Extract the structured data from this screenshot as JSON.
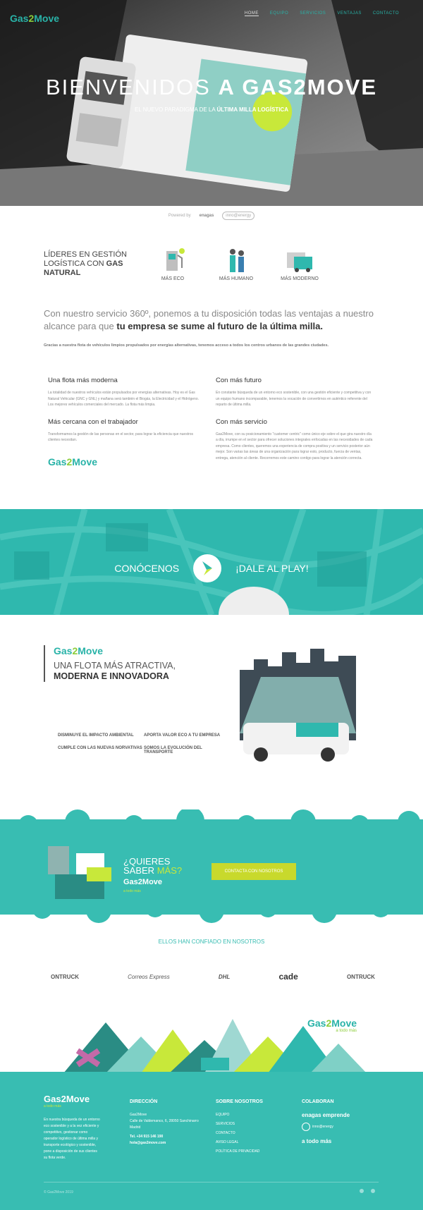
{
  "header": {
    "logo_prefix": "Gas",
    "logo_two": "2",
    "logo_suffix": "Move",
    "nav": [
      "HOME",
      "EQUIPO",
      "SERVICIOS",
      "VENTAJAS",
      "CONTACTO"
    ]
  },
  "hero": {
    "title_light": "BIENVENIDOS ",
    "title_bold": "A GAS2MOVE",
    "subtitle_pre": "EL NUEVO PARADIGMA DE LA ",
    "subtitle_bold": "ÚLTIMA MILLA LOGÍSTICA"
  },
  "powered": {
    "label": "Powered by",
    "brand1": "enagas",
    "brand2": "inno@energy"
  },
  "leaders": {
    "line1": "LÍDERES EN GESTIÓN",
    "line2": "LOGÍSTICA CON ",
    "line2_bold": "GAS",
    "line3": "NATURAL"
  },
  "pillars": [
    {
      "label": "MÁS ECO",
      "icon": "gas-pump-icon"
    },
    {
      "label": "MÁS HUMANO",
      "icon": "people-icon"
    },
    {
      "label": "MÁS MODERNO",
      "icon": "van-icon"
    }
  ],
  "intro": {
    "text1": "Con nuestro servicio 360º, ponemos a tu disposición todas las ventajas a nuestro alcance para que ",
    "bold": "tu empresa se sume al futuro de la última milla.",
    "note": "Gracias a nuestra flota de vehículos limpios propulsados por energías alternativas, tenemos acceso a todos los centros urbanos de las grandes ciudades."
  },
  "features": {
    "f1_title": "Una flota más moderna",
    "f1_text": "La totalidad de nuestros vehículos están propulsados por energías alternativas. Hoy es el Gas Natural Vehicular (GNC y GNL) y mañana será también el Biogás, la Electricidad y el Hidrógeno. Los mejores vehículos comerciales del mercado. La flota más limpia.",
    "f2_title": "Más cercana con el trabajador",
    "f2_text": "Transformamos la gestión de las personas en el sector, para lograr la eficiencia que nuestros clientes necesitan.",
    "f3_title": "Con más futuro",
    "f3_text": "En constante búsqueda de un entorno eco sostenible, con una gestión eficiente y competitiva y con un equipo humano incomparable, tenemos la vocación de convertirnos en auténtico referente del reparto de última milla.",
    "f4_title": "Con más servicio",
    "f4_text": "Gas2Move, con su posicionamiento \"customer centric\" como único eje sobre el que gira nuestro día a día, irrumpe en el sector para ofrecer soluciones integrales enfocadas en las necesidades de cada empresa. Como clientes, queremos una experiencia de compra positiva y un servicio posterior aún mejor. Son varias las áreas de una organización para lograr esto, producto, fuerza de ventas, entrega, atención al cliente. Recorremos este camino contigo para lograr la atención correcta."
  },
  "video": {
    "left": "CONÓCENOS",
    "right": "¡DALE AL PLAY!"
  },
  "fleet": {
    "title_line1": "UNA FLOTA MÁS ATRACTIVA,",
    "title_line2": "MODERNA E INNOVADORA",
    "benefits": [
      "DISMINUYE EL IMPACTO AMBIENTAL",
      "APORTA VALOR ECO A TU EMPRESA",
      "CUMPLE CON LAS NUEVAS NORVATIVAS",
      "SOMOS LA EVOLUCIÓN DEL TRANSPORTE"
    ]
  },
  "cta": {
    "q1": "¿QUIERES",
    "q2": "SABER ",
    "q2b": "MÁS?",
    "button": "CONTACTA CON NOSOTROS",
    "tag": "a todo más"
  },
  "trusted": {
    "title": "ELLOS HAN CONFIADO EN NOSOTROS",
    "clients": [
      "ONTRUCK",
      "Correos Express",
      "DHL",
      "cade",
      "ONTRUCK"
    ]
  },
  "footer": {
    "about": "En nuestra búsqueda de un entorno eco sostenible y a la vez eficiente y competitivo, gestionar como operador logístico de última milla y transporte ecológico y sostenible, pone a disposición de sus clientes su flota verde.",
    "direccion_title": "DIRECCIÓN",
    "direccion_lines": [
      "Gas2Move",
      "Calle de Valdemanco, 6, 28050 Sanchinarro",
      "Madrid"
    ],
    "tel": "Tel. +34 915 146 190",
    "email": "hola@gas2move.com",
    "sobre_title": "SOBRE NOSOTROS",
    "sobre_links": [
      "EQUIPO",
      "SERVICIOS",
      "CONTACTO",
      "AVISO LEGAL",
      "POLÍTICA DE PRIVACIDAD"
    ],
    "colaboran_title": "COLABORAN",
    "colab1": "enagas emprende",
    "colab2": "inno@energy",
    "colab3": "a todo más",
    "copyright": "© Gas2Move 2019"
  }
}
